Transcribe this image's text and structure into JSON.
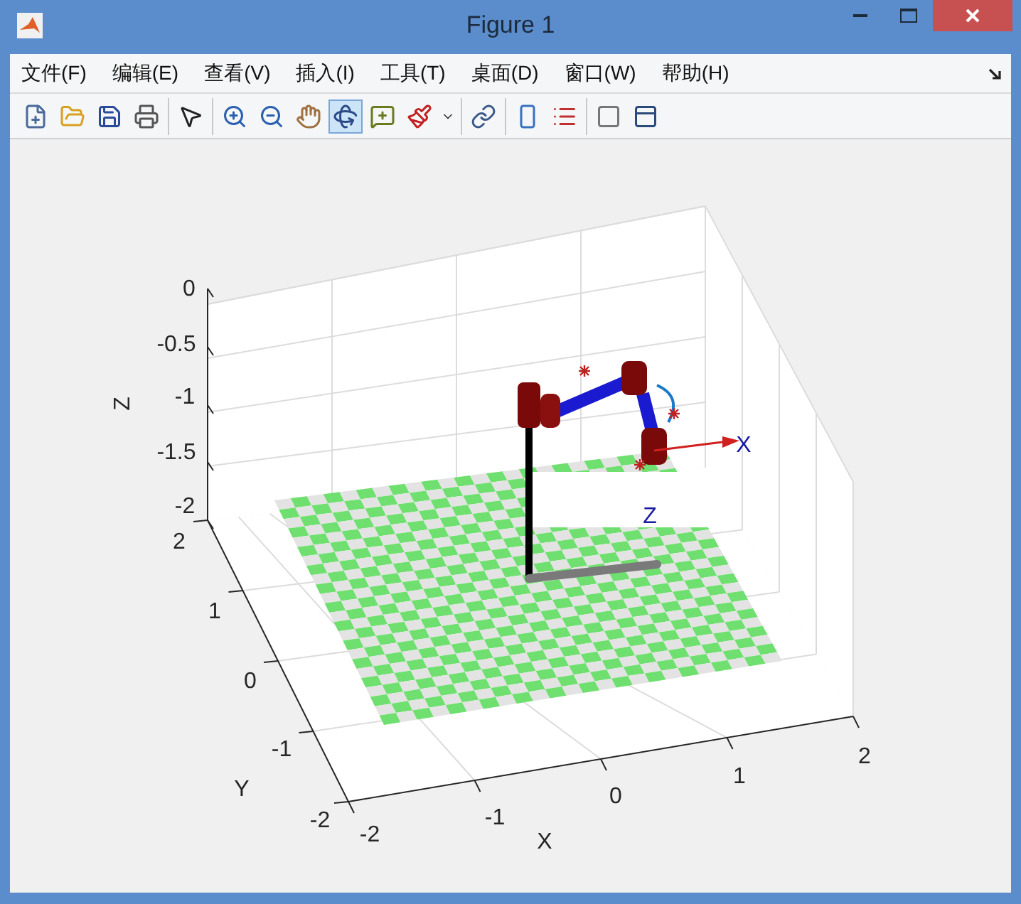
{
  "window": {
    "title": "Figure 1"
  },
  "menu": [
    "文件(F)",
    "编辑(E)",
    "查看(V)",
    "插入(I)",
    "工具(T)",
    "桌面(D)",
    "窗口(W)",
    "帮助(H)"
  ],
  "toolbar": [
    [
      {
        "kind": "new",
        "selected": false
      },
      {
        "kind": "open",
        "selected": false
      },
      {
        "kind": "save",
        "selected": false
      },
      {
        "kind": "print",
        "selected": false
      }
    ],
    [
      {
        "kind": "pointer",
        "selected": false
      }
    ],
    [
      {
        "kind": "zoom-in",
        "selected": false
      },
      {
        "kind": "zoom-out",
        "selected": false
      },
      {
        "kind": "pan",
        "selected": false
      },
      {
        "kind": "rotate",
        "selected": true
      },
      {
        "kind": "data-cursor",
        "selected": false
      },
      {
        "kind": "brush",
        "selected": false
      },
      {
        "kind": "caret",
        "selected": false
      }
    ],
    [
      {
        "kind": "link",
        "selected": false
      }
    ],
    [
      {
        "kind": "colorbar",
        "selected": false
      },
      {
        "kind": "legend",
        "selected": false
      }
    ],
    [
      {
        "kind": "hide",
        "selected": false
      },
      {
        "kind": "show",
        "selected": false
      }
    ]
  ],
  "axes": {
    "xlabel": "X",
    "ylabel": "Y",
    "zlabel": "Z",
    "xticks": [
      "-2",
      "-1",
      "0",
      "1",
      "2"
    ],
    "yticks": [
      "2",
      "1",
      "0",
      "-1",
      "-2"
    ],
    "zticks": [
      "0",
      "-0.5",
      "-1",
      "-1.5",
      "-2"
    ]
  },
  "frame_labels": [
    "X",
    "Z"
  ]
}
